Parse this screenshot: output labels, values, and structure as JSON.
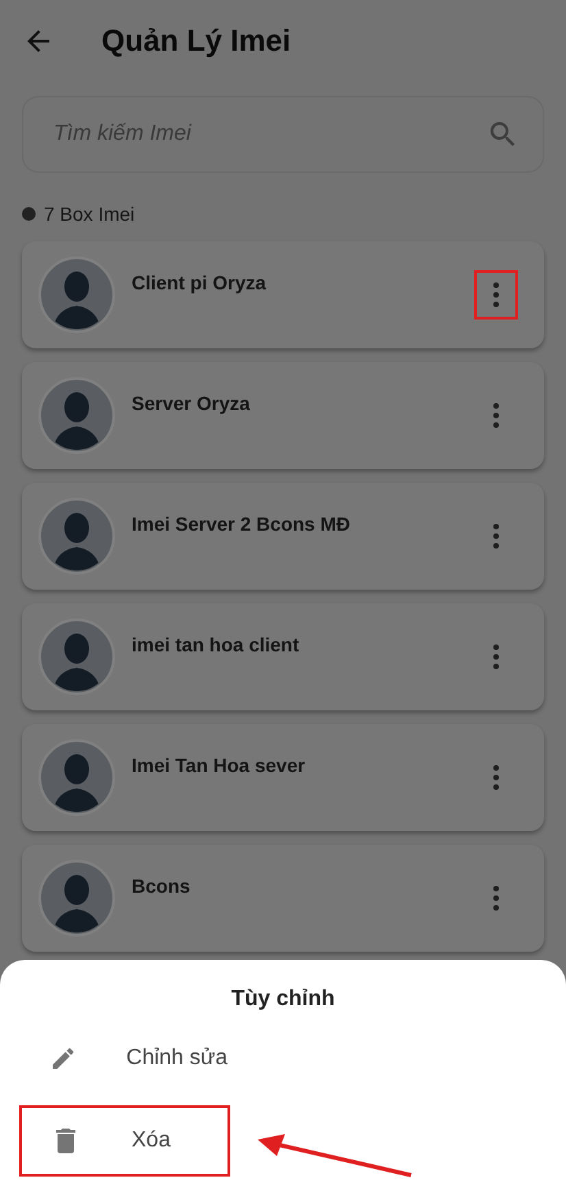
{
  "header": {
    "title": "Quản Lý Imei"
  },
  "search": {
    "placeholder": "Tìm kiếm Imei"
  },
  "count_label": "7 Box Imei",
  "devices": [
    {
      "name": "Client pi Oryza",
      "menu_highlighted": true
    },
    {
      "name": "Server Oryza",
      "menu_highlighted": false
    },
    {
      "name": "Imei Server 2 Bcons MĐ",
      "menu_highlighted": false
    },
    {
      "name": "imei tan hoa client",
      "menu_highlighted": false
    },
    {
      "name": "Imei Tan Hoa sever",
      "menu_highlighted": false
    },
    {
      "name": "Bcons",
      "menu_highlighted": false
    }
  ],
  "sheet": {
    "title": "Tùy chỉnh",
    "items": [
      {
        "kind": "edit",
        "label": "Chỉnh sửa",
        "highlighted": false
      },
      {
        "kind": "delete",
        "label": "Xóa",
        "highlighted": true
      }
    ],
    "pointer_arrow": true
  }
}
